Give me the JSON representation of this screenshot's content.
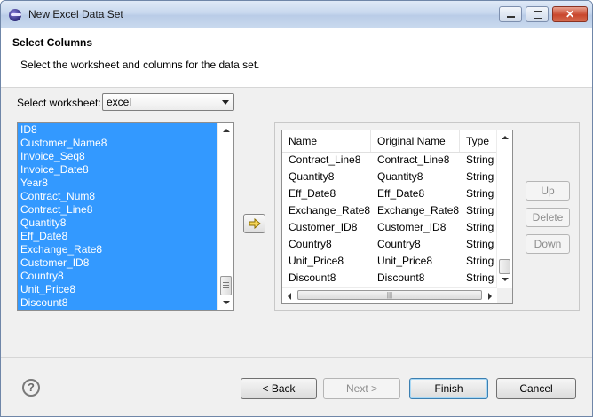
{
  "window": {
    "title": "New Excel Data Set",
    "close_glyph": "✕"
  },
  "header": {
    "title": "Select Columns",
    "description": "Select the worksheet and columns for the data set."
  },
  "worksheet": {
    "label": "Select worksheet:",
    "value": "excel"
  },
  "available_columns": [
    "ID8",
    "Customer_Name8",
    "Invoice_Seq8",
    "Invoice_Date8",
    "Year8",
    "Contract_Num8",
    "Contract_Line8",
    "Quantity8",
    "Eff_Date8",
    "Exchange_Rate8",
    "Customer_ID8",
    "Country8",
    "Unit_Price8",
    "Discount8"
  ],
  "selected_table": {
    "headers": {
      "name": "Name",
      "original": "Original Name",
      "type": "Type"
    },
    "rows": [
      {
        "name": "Contract_Line8",
        "original": "Contract_Line8",
        "type": "String"
      },
      {
        "name": "Quantity8",
        "original": "Quantity8",
        "type": "String"
      },
      {
        "name": "Eff_Date8",
        "original": "Eff_Date8",
        "type": "String"
      },
      {
        "name": "Exchange_Rate8",
        "original": "Exchange_Rate8",
        "type": "String"
      },
      {
        "name": "Customer_ID8",
        "original": "Customer_ID8",
        "type": "String"
      },
      {
        "name": "Country8",
        "original": "Country8",
        "type": "String"
      },
      {
        "name": "Unit_Price8",
        "original": "Unit_Price8",
        "type": "String"
      },
      {
        "name": "Discount8",
        "original": "Discount8",
        "type": "String"
      }
    ]
  },
  "side_buttons": {
    "up": "Up",
    "delete": "Delete",
    "down": "Down"
  },
  "footer": {
    "help_glyph": "?",
    "back": "< Back",
    "next": "Next >",
    "finish": "Finish",
    "cancel": "Cancel"
  },
  "colors": {
    "selection": "#3399ff",
    "dialog_bg": "#f0f0f0",
    "header_bg": "#ffffff"
  }
}
